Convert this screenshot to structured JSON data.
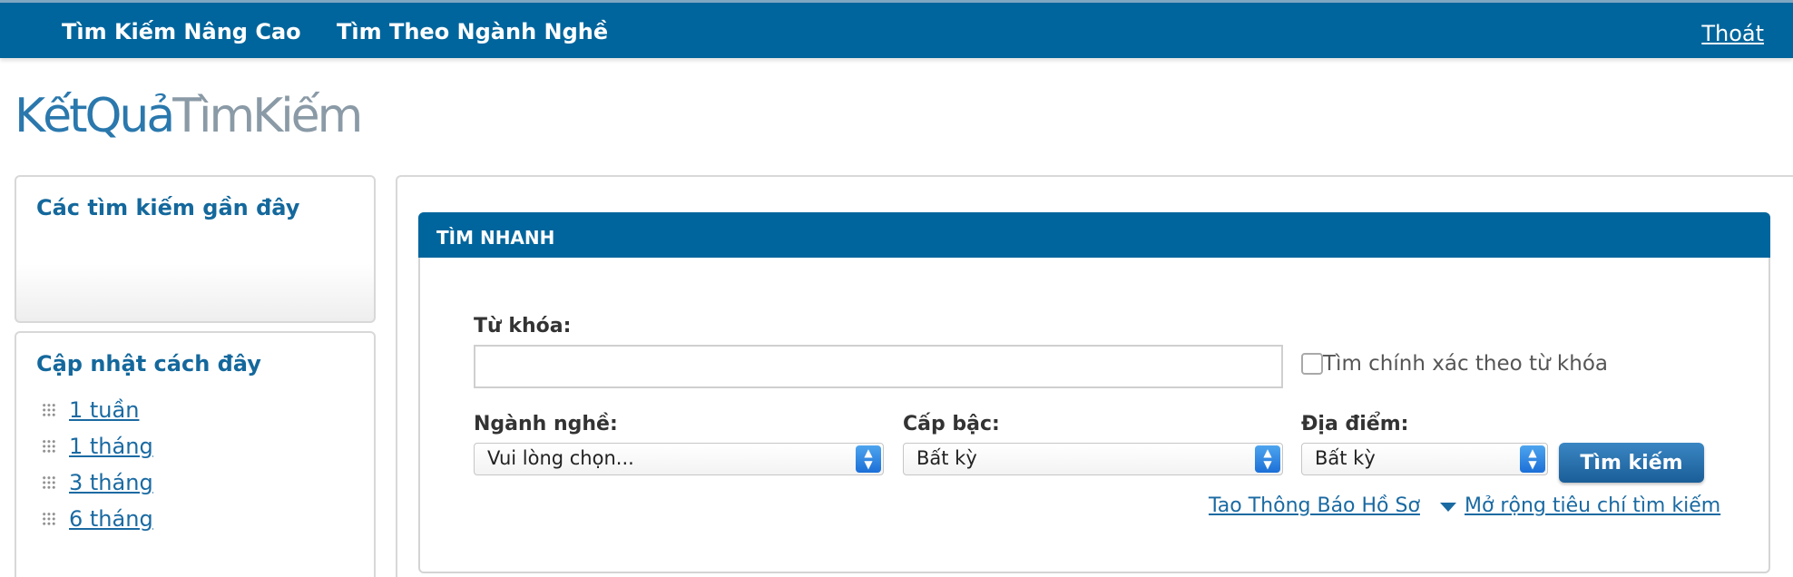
{
  "nav": {
    "advanced_search": "Tìm Kiếm Nâng Cao",
    "search_by_industry": "Tìm Theo Ngành Nghề",
    "logout": "Thoát"
  },
  "page_title": {
    "part1": "KếtQuả",
    "part2": "TìmKiếm"
  },
  "sidebar": {
    "recent_title": "Các tìm kiếm gần đây",
    "updated_title": "Cập nhật cách đây",
    "updated_items": [
      {
        "label": "1 tuần"
      },
      {
        "label": "1 tháng"
      },
      {
        "label": "3 tháng"
      },
      {
        "label": "6 tháng"
      }
    ]
  },
  "quick_search": {
    "header": "TÌM NHANH",
    "keyword_label": "Từ khóa:",
    "keyword_value": "",
    "exact_match_label": "Tìm chính xác theo từ khóa",
    "exact_match_checked": false,
    "industry_label": "Ngành nghề:",
    "industry_value": "Vui lòng chọn...",
    "level_label": "Cấp bậc:",
    "level_value": "Bất kỳ",
    "location_label": "Địa điểm:",
    "location_value": "Bất kỳ",
    "search_button": "Tìm kiếm",
    "create_alert_link": "Tao Thông Báo Hồ Sơ",
    "expand_criteria_link": "Mở rộng tiêu chí tìm kiếm"
  },
  "colors": {
    "primary": "#00659c",
    "link": "#1a6aa2",
    "title_accent": "#2a78ad",
    "title_muted": "#8a9aa6"
  }
}
